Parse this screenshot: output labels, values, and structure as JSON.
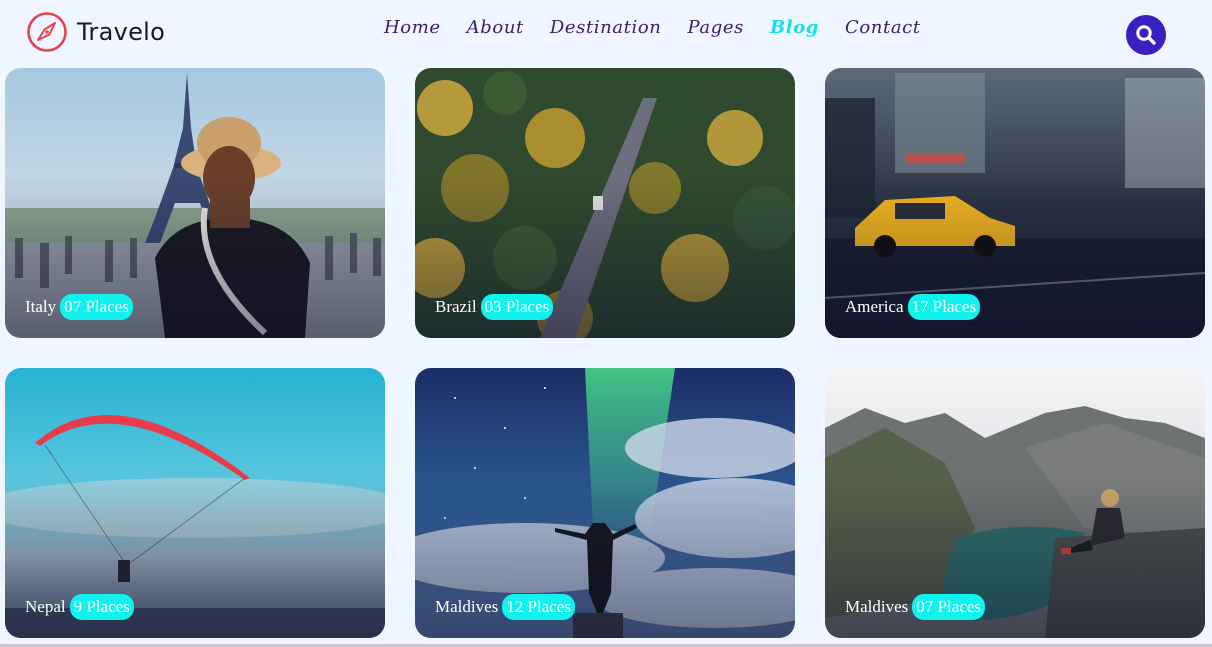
{
  "brand": {
    "name": "Travelo",
    "icon": "compass-icon",
    "accent": "#e8414f"
  },
  "nav": {
    "items": [
      {
        "label": "Home",
        "active": false
      },
      {
        "label": "About",
        "active": false
      },
      {
        "label": "Destination",
        "active": false
      },
      {
        "label": "Pages",
        "active": false
      },
      {
        "label": "Blog",
        "active": true
      },
      {
        "label": "Contact",
        "active": false
      }
    ],
    "search_icon": "search-icon",
    "search_color": "#3a1fc1"
  },
  "destinations": [
    {
      "name": "Italy",
      "places": "07 Places",
      "scene": "eiffel-tower-portrait"
    },
    {
      "name": "Brazil",
      "places": "03 Places",
      "scene": "forest-road-aerial"
    },
    {
      "name": "America",
      "places": "17 Places",
      "scene": "city-taxi-motion"
    },
    {
      "name": "Nepal",
      "places": "9 Places",
      "scene": "paraglider-sky"
    },
    {
      "name": "Maldives",
      "places": "12 Places",
      "scene": "aurora-night-sky"
    },
    {
      "name": "Maldives",
      "places": "07 Places",
      "scene": "mountain-lake-overlook"
    }
  ],
  "colors": {
    "badge": "#0ff2ee",
    "nav_text": "#3f1b6b",
    "nav_active": "#18e0e8",
    "page_bg": "#f0f6ff"
  }
}
